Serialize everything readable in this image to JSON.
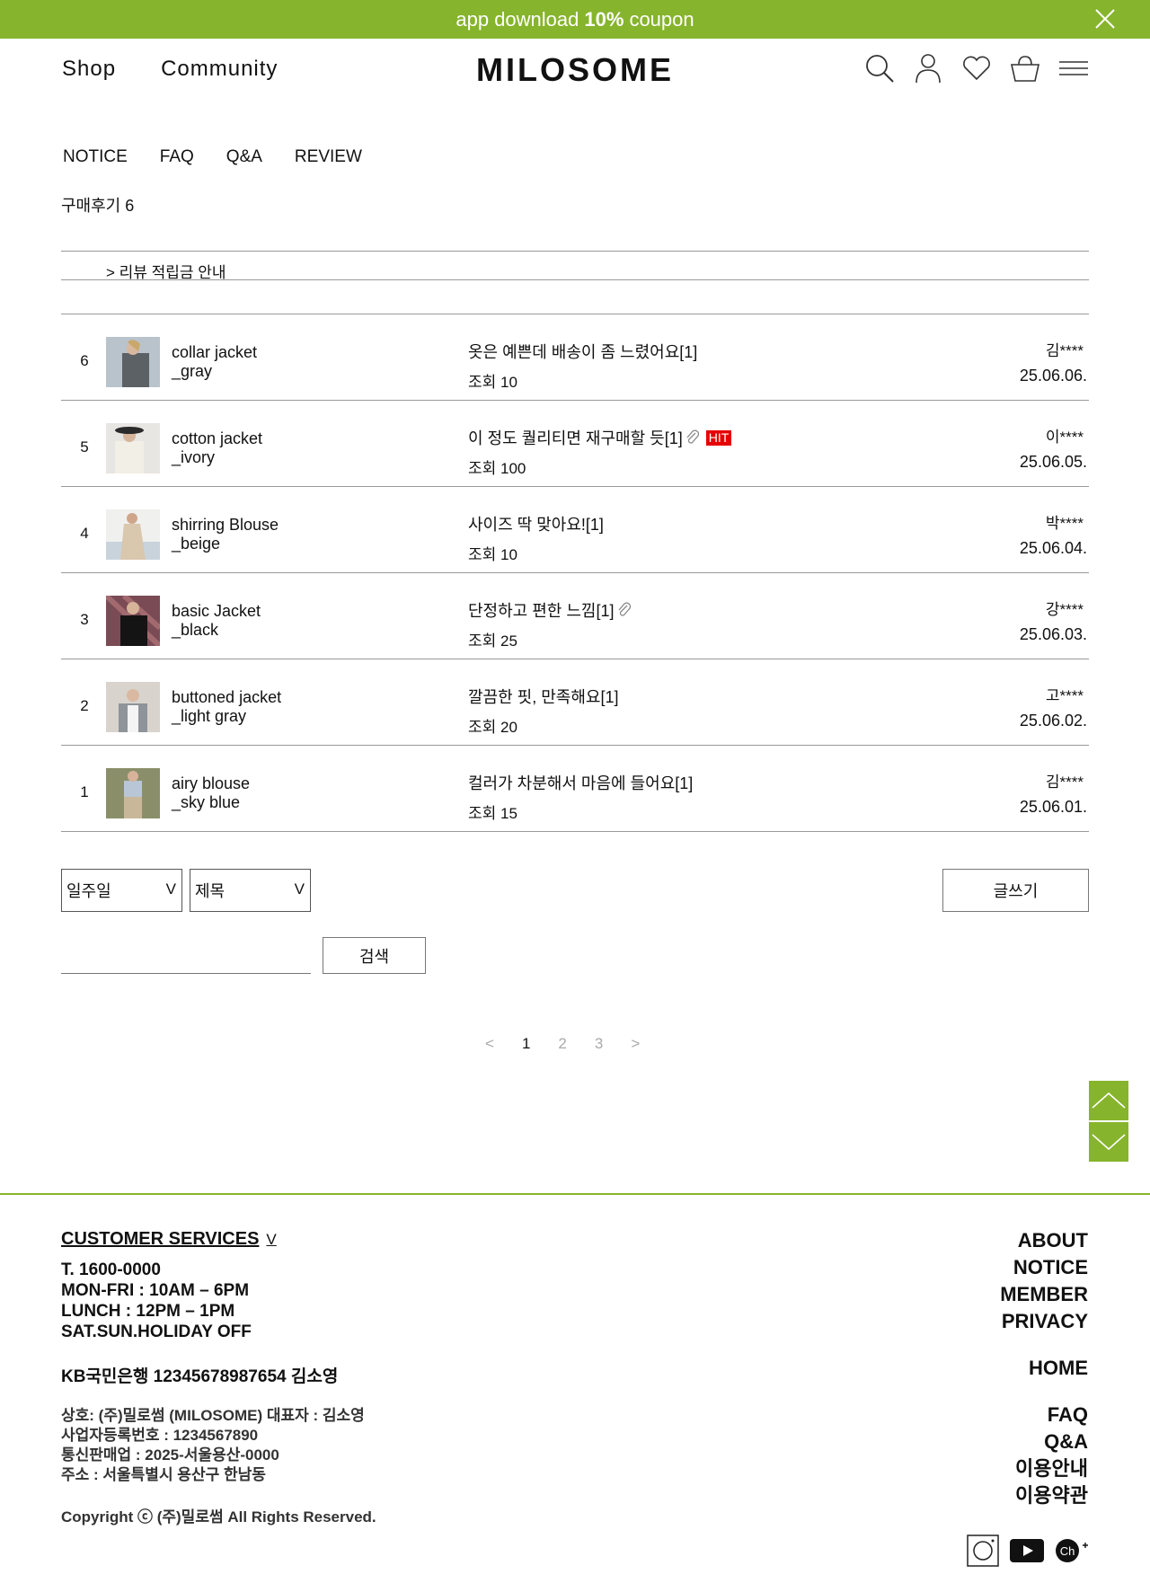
{
  "banner": {
    "prefix": "app download",
    "highlight": "10%",
    "suffix": "coupon"
  },
  "header": {
    "nav": [
      "Shop",
      "Community"
    ],
    "logo": "MILOSOME"
  },
  "board": {
    "tabs": [
      "NOTICE",
      "FAQ",
      "Q&A",
      "REVIEW"
    ],
    "count_label": "구매후기 6",
    "notice": "> 리뷰 적립금 안내"
  },
  "reviews": [
    {
      "num": "6",
      "name1": "collar jacket",
      "name2": "_gray",
      "title": "옷은 예쁜데 배송이 좀 느렸어요[1]",
      "views": "조회 10",
      "author": "김****",
      "date": "25.06.06.",
      "attach": false,
      "hit": ""
    },
    {
      "num": "5",
      "name1": "cotton jacket",
      "name2": "_ivory",
      "title": "이 정도 퀄리티면 재구매할 듯[1]",
      "views": "조회 100",
      "author": "이****",
      "date": "25.06.05.",
      "attach": true,
      "hit": "HIT"
    },
    {
      "num": "4",
      "name1": "shirring Blouse",
      "name2": "_beige",
      "title": "사이즈 딱 맞아요![1]",
      "views": "조회 10",
      "author": "박****",
      "date": "25.06.04.",
      "attach": false,
      "hit": ""
    },
    {
      "num": "3",
      "name1": "basic Jacket",
      "name2": "_black",
      "title": "단정하고 편한 느낌[1]",
      "views": "조회 25",
      "author": "강****",
      "date": "25.06.03.",
      "attach": true,
      "hit": ""
    },
    {
      "num": "2",
      "name1": "buttoned jacket",
      "name2": "_light gray",
      "title": "깔끔한 핏, 만족해요[1]",
      "views": "조회 20",
      "author": "고****",
      "date": "25.06.02.",
      "attach": false,
      "hit": ""
    },
    {
      "num": "1",
      "name1": "airy blouse",
      "name2": "_sky blue",
      "title": "컬러가 차분해서 마음에 들어요[1]",
      "views": "조회 15",
      "author": "김****",
      "date": "25.06.01.",
      "attach": false,
      "hit": ""
    }
  ],
  "controls": {
    "period_select": "일주일",
    "field_select": "제목",
    "write_button": "글쓰기",
    "search_button": "검색",
    "chevron": "V"
  },
  "pagination": {
    "prev": "<",
    "pages": [
      "1",
      "2",
      "3"
    ],
    "next": ">",
    "current": "1"
  },
  "footer": {
    "cs_title": "CUSTOMER SERVICES",
    "cs_lines": [
      "T. 1600-0000",
      "MON-FRI : 10AM – 6PM",
      "LUNCH : 12PM – 1PM",
      "SAT.SUN.HOLIDAY OFF"
    ],
    "bank": "KB국민은행 12345678987654 김소영",
    "biz_lines": [
      "상호: (주)밀로썸 (MILOSOME)  대표자 : 김소영",
      "사업자등록번호 : 1234567890",
      "통신판매업 : 2025-서울용산-0000",
      "주소 : 서울특별시 용산구 한남동"
    ],
    "copyright": "Copyright ⓒ (주)밀로썸 All Rights Reserved.",
    "links_a": [
      "ABOUT",
      "NOTICE",
      "MEMBER",
      "PRIVACY"
    ],
    "link_home": "HOME",
    "links_b": [
      "FAQ",
      "Q&A",
      "이용안내",
      "이용약관"
    ],
    "social_kakao": "Ch"
  },
  "colors": {
    "accent": "#86b42c",
    "hit": "#e60000"
  },
  "icons": [
    "close-icon",
    "search-icon",
    "user-icon",
    "heart-icon",
    "cart-icon",
    "menu-icon",
    "paperclip-icon",
    "arrow-up-icon",
    "arrow-down-icon",
    "instagram-icon",
    "youtube-icon",
    "kakao-channel-icon"
  ]
}
